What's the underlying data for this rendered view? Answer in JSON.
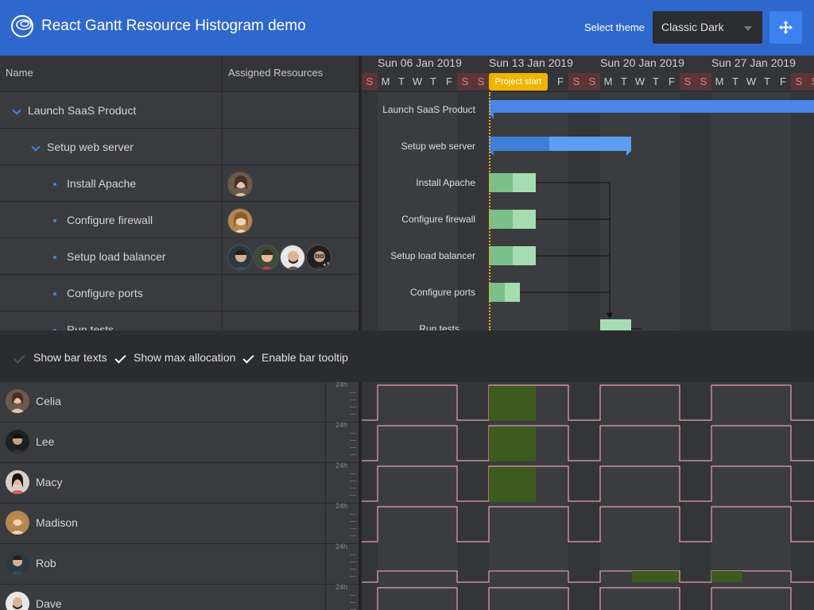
{
  "header": {
    "title": "React Gantt Resource Histogram demo",
    "theme_label": "Select theme",
    "theme_value": "Classic Dark"
  },
  "colors": {
    "header_bg": "#2f68cc",
    "parent_bar": "#4a86e8",
    "leaf_bar": "#8fd19e",
    "alloc_bar": "#3d5b1e",
    "max_line": "#e6a3a8",
    "project_start": "#f0b400"
  },
  "grid": {
    "col_name": "Name",
    "col_resources": "Assigned Resources",
    "rows": [
      {
        "name": "Launch SaaS Product",
        "level": 0,
        "type": "parent"
      },
      {
        "name": "Setup web server",
        "level": 1,
        "type": "parent"
      },
      {
        "name": "Install Apache",
        "level": 2,
        "type": "leaf",
        "resources": [
          "celia"
        ]
      },
      {
        "name": "Configure firewall",
        "level": 2,
        "type": "leaf",
        "resources": [
          "madison"
        ]
      },
      {
        "name": "Setup load balancer",
        "level": 2,
        "type": "leaf",
        "resources": [
          "lee",
          "rob",
          "dave",
          "lee"
        ]
      },
      {
        "name": "Configure ports",
        "level": 2,
        "type": "leaf"
      },
      {
        "name": "Run tests",
        "level": 2,
        "type": "leaf"
      }
    ]
  },
  "timeline": {
    "weeks": [
      "Sun 06 Jan 2019",
      "Sun 13 Jan 2019",
      "Sun 20 Jan 2019",
      "Sun 27 Jan 2019"
    ],
    "days": [
      "S",
      "M",
      "T",
      "W",
      "T",
      "F",
      "S",
      "S",
      "M",
      "T",
      "W",
      "T",
      "F",
      "S",
      "S",
      "M",
      "T",
      "W",
      "T",
      "F",
      "S",
      "S",
      "M",
      "T",
      "W",
      "T",
      "F",
      "S",
      "S"
    ],
    "project_start_label": "Project start"
  },
  "toolbar": {
    "show_bar_texts": "Show bar texts",
    "show_max_allocation": "Show max allocation",
    "enable_bar_tooltip": "Enable bar tooltip"
  },
  "resources": {
    "scale_label": "24h",
    "items": [
      {
        "name": "Celia"
      },
      {
        "name": "Lee"
      },
      {
        "name": "Macy"
      },
      {
        "name": "Madison"
      },
      {
        "name": "Rob"
      },
      {
        "name": "Dave"
      }
    ]
  }
}
